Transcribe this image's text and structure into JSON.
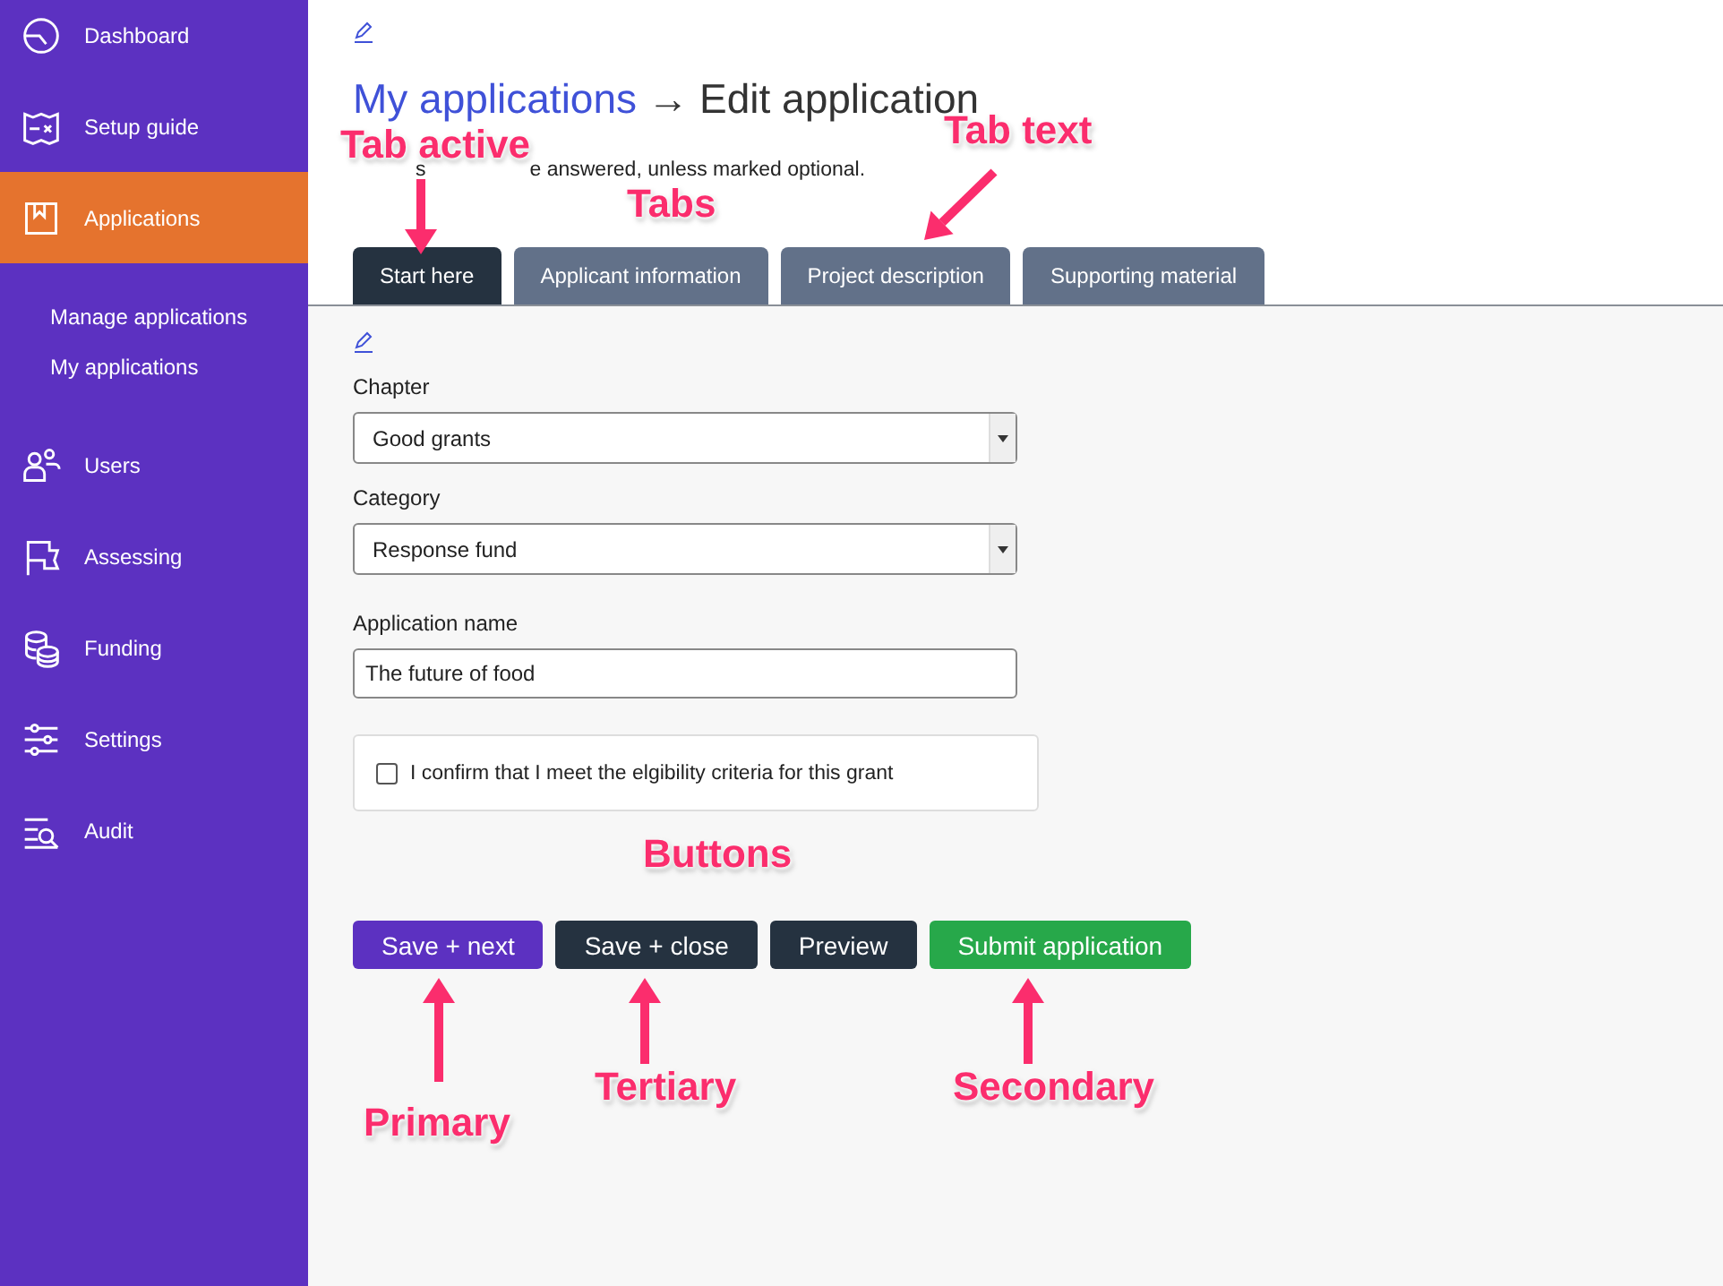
{
  "sidebar": {
    "items": [
      {
        "label": "Dashboard",
        "selected": false
      },
      {
        "label": "Setup guide",
        "selected": false
      },
      {
        "label": "Applications",
        "selected": true,
        "expanded": true,
        "children": [
          {
            "label": "Manage applications",
            "selected": false
          },
          {
            "label": "My applications",
            "selected": false
          }
        ]
      },
      {
        "label": "Users",
        "selected": false
      },
      {
        "label": "Assessing",
        "selected": false
      },
      {
        "label": "Funding",
        "selected": false
      },
      {
        "label": "Settings",
        "selected": false
      },
      {
        "label": "Audit",
        "selected": false
      }
    ]
  },
  "breadcrumb": {
    "link": "My applications",
    "separator": "→",
    "current": "Edit application"
  },
  "hint": [
    "s",
    "e answered, unless marked optional."
  ],
  "tabs": [
    {
      "label": "Start here",
      "selected": true
    },
    {
      "label": "Applicant information",
      "selected": false
    },
    {
      "label": "Project description",
      "selected": false
    },
    {
      "label": "Supporting material",
      "selected": false
    }
  ],
  "fields": [
    {
      "kind": "select",
      "label": "Chapter",
      "value": "Good grants"
    },
    {
      "kind": "select",
      "label": "Category",
      "value": "Response fund"
    },
    {
      "kind": "text",
      "label": "Application name",
      "value": "The future of food"
    },
    {
      "kind": "checkbox",
      "label": "I confirm that I meet the elgibility criteria for this grant",
      "checked": false
    }
  ],
  "buttons": [
    {
      "label": "Save + next",
      "kind": "primary"
    },
    {
      "label": "Save + close",
      "kind": "tertiary"
    },
    {
      "label": "Preview",
      "kind": "tertiary"
    },
    {
      "label": "Submit application",
      "kind": "secondary"
    }
  ],
  "annotations": [
    {
      "text": "Tab text"
    },
    {
      "text": "Tab active"
    },
    {
      "text": "Tabs"
    },
    {
      "text": "Buttons"
    },
    {
      "text": "Tertiary"
    },
    {
      "text": "Secondary"
    },
    {
      "text": "Primary"
    }
  ]
}
